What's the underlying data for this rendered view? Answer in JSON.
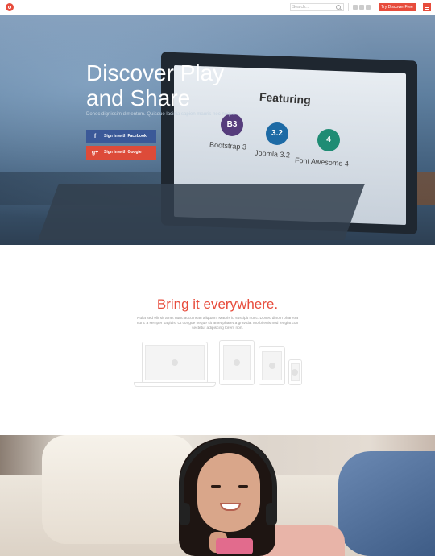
{
  "header": {
    "search_placeholder": "Search...",
    "social_icons": [
      "facebook-icon",
      "twitter-icon",
      "google-plus-icon"
    ],
    "cta_label": "Try Discover Free",
    "menu_icon": "hamburger-icon",
    "accent_color": "#e74c3c"
  },
  "hero": {
    "title_line1": "Discover Play",
    "title_line2": "and Share",
    "subtitle": "Donec dignissim dimentum. Quisque lacinia sapien mauris nec neque.",
    "facebook_button": "Sign in with Facebook",
    "google_button": "Sign in with Google",
    "screen": {
      "heading": "Featuring",
      "badges": [
        {
          "symbol": "B3",
          "label": "Bootstrap 3",
          "color": "#563d7c"
        },
        {
          "symbol": "3.2",
          "label": "Joomla 3.2",
          "color": "#1d6aa5"
        },
        {
          "symbol": "4",
          "label": "Font Awesome 4",
          "color": "#1f8c74"
        }
      ]
    }
  },
  "features": {
    "title": "Bring it everywhere.",
    "text": "Nulla sed elit sit amet nunc accumsan aliquam. Mauris id suscipit nunc. Donec dinom pharetra nunc a semper sagittis. Ut congue neque sit amet pharetra gravida. Morbi euismod feugiat con sectetur adipiscing lorem non.",
    "devices": [
      "laptop-icon",
      "tablet-icon",
      "tablet-small-icon",
      "phone-icon"
    ]
  }
}
